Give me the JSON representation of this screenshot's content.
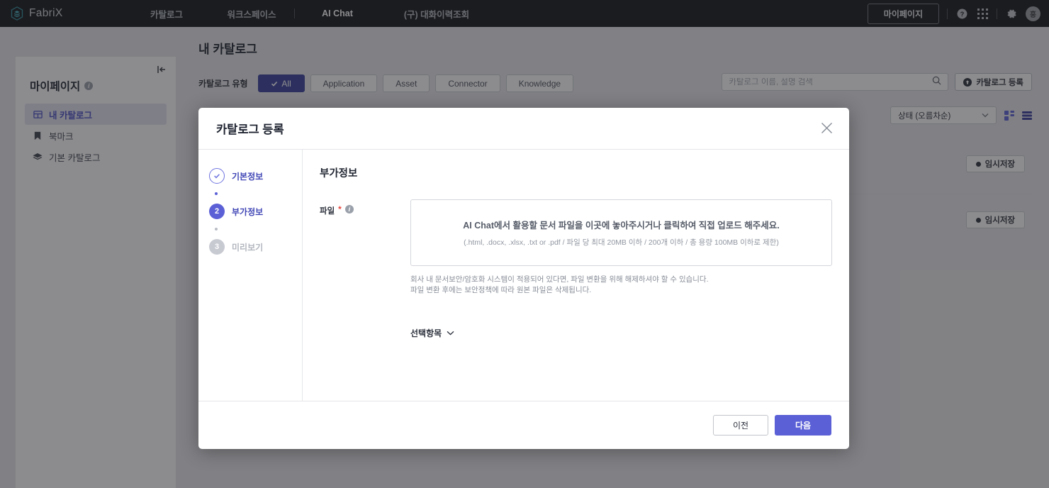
{
  "topbar": {
    "brand": "FabriX",
    "brand_icon": "layers-hexagon-icon",
    "nav": [
      {
        "label": "카탈로그",
        "active": false
      },
      {
        "label": "워크스페이스",
        "active": false
      },
      {
        "label": "AI Chat",
        "active": true
      },
      {
        "label": "(구) 대화이력조회",
        "active": false
      }
    ],
    "mypage_label": "마이페이지",
    "help_icon": "help-circle-icon",
    "apps_icon": "grid-apps-icon",
    "settings_icon": "gear-icon",
    "avatar_initial": "홍"
  },
  "sidebar": {
    "collapse_icon": "collapse-left-icon",
    "title": "마이페이지",
    "info_icon": "info-icon",
    "items": [
      {
        "label": "내 카탈로그",
        "icon": "catalog-icon",
        "active": true
      },
      {
        "label": "북마크",
        "icon": "bookmark-icon",
        "active": false
      },
      {
        "label": "기본 카탈로그",
        "icon": "layers-icon",
        "active": false
      }
    ]
  },
  "main": {
    "page_title": "내 카탈로그",
    "filter_label": "카탈로그 유형",
    "filters": [
      {
        "label": "All",
        "active": true,
        "check_icon": "check-icon"
      },
      {
        "label": "Application",
        "active": false
      },
      {
        "label": "Asset",
        "active": false
      },
      {
        "label": "Connector",
        "active": false
      },
      {
        "label": "Knowledge",
        "active": false
      }
    ],
    "search": {
      "placeholder": "카탈로그 이름, 설명 검색",
      "value": "",
      "icon": "search-icon"
    },
    "register_button": {
      "label": "카탈로그 등록",
      "icon": "upload-circle-icon"
    },
    "sort": {
      "value": "상태 (오름차순)",
      "chevron_icon": "chevron-down-icon"
    },
    "view_grid_icon": "grid-view-icon",
    "view_list_icon": "list-view-icon",
    "rows": [
      {
        "status_badge": "임시저장"
      },
      {
        "status_badge": "임시저장"
      }
    ]
  },
  "modal": {
    "title": "카탈로그 등록",
    "close_icon": "close-icon",
    "steps": [
      {
        "num": "✓",
        "label": "기본정보",
        "state": "done"
      },
      {
        "num": "2",
        "label": "부가정보",
        "state": "current"
      },
      {
        "num": "3",
        "label": "미리보기",
        "state": "todo"
      }
    ],
    "form": {
      "heading": "부가정보",
      "file_label": "파일",
      "required_mark": "*",
      "file_info_icon": "info-icon",
      "dropzone_main": "AI Chat에서 활용할 문서 파일을 이곳에 놓아주시거나 클릭하여 직접 업로드 해주세요.",
      "dropzone_sub": "(.html, .docx, .xlsx, .txt or .pdf / 파일 당 최대 20MB 이하 / 200개 이하 / 총 용량 100MB 이하로 제한)",
      "hint_line1": "회사 내 문서보안/암호화 시스템이 적용되어 있다면, 파일 변환을 위해 해제하셔야 할 수 있습니다.",
      "hint_line2": "파일 변환 후에는 보안정책에 따라 원본 파일은 삭제됩니다.",
      "optional_label": "선택항목",
      "optional_chevron_icon": "chevron-down-icon"
    },
    "prev_label": "이전",
    "next_label": "다음"
  },
  "colors": {
    "accent_indigo": "#5b60d6",
    "chip_active": "#3a3f9e",
    "topbar_bg": "#14161a",
    "brand_teal": "#3e9aa8",
    "required_red": "#e8453c"
  }
}
